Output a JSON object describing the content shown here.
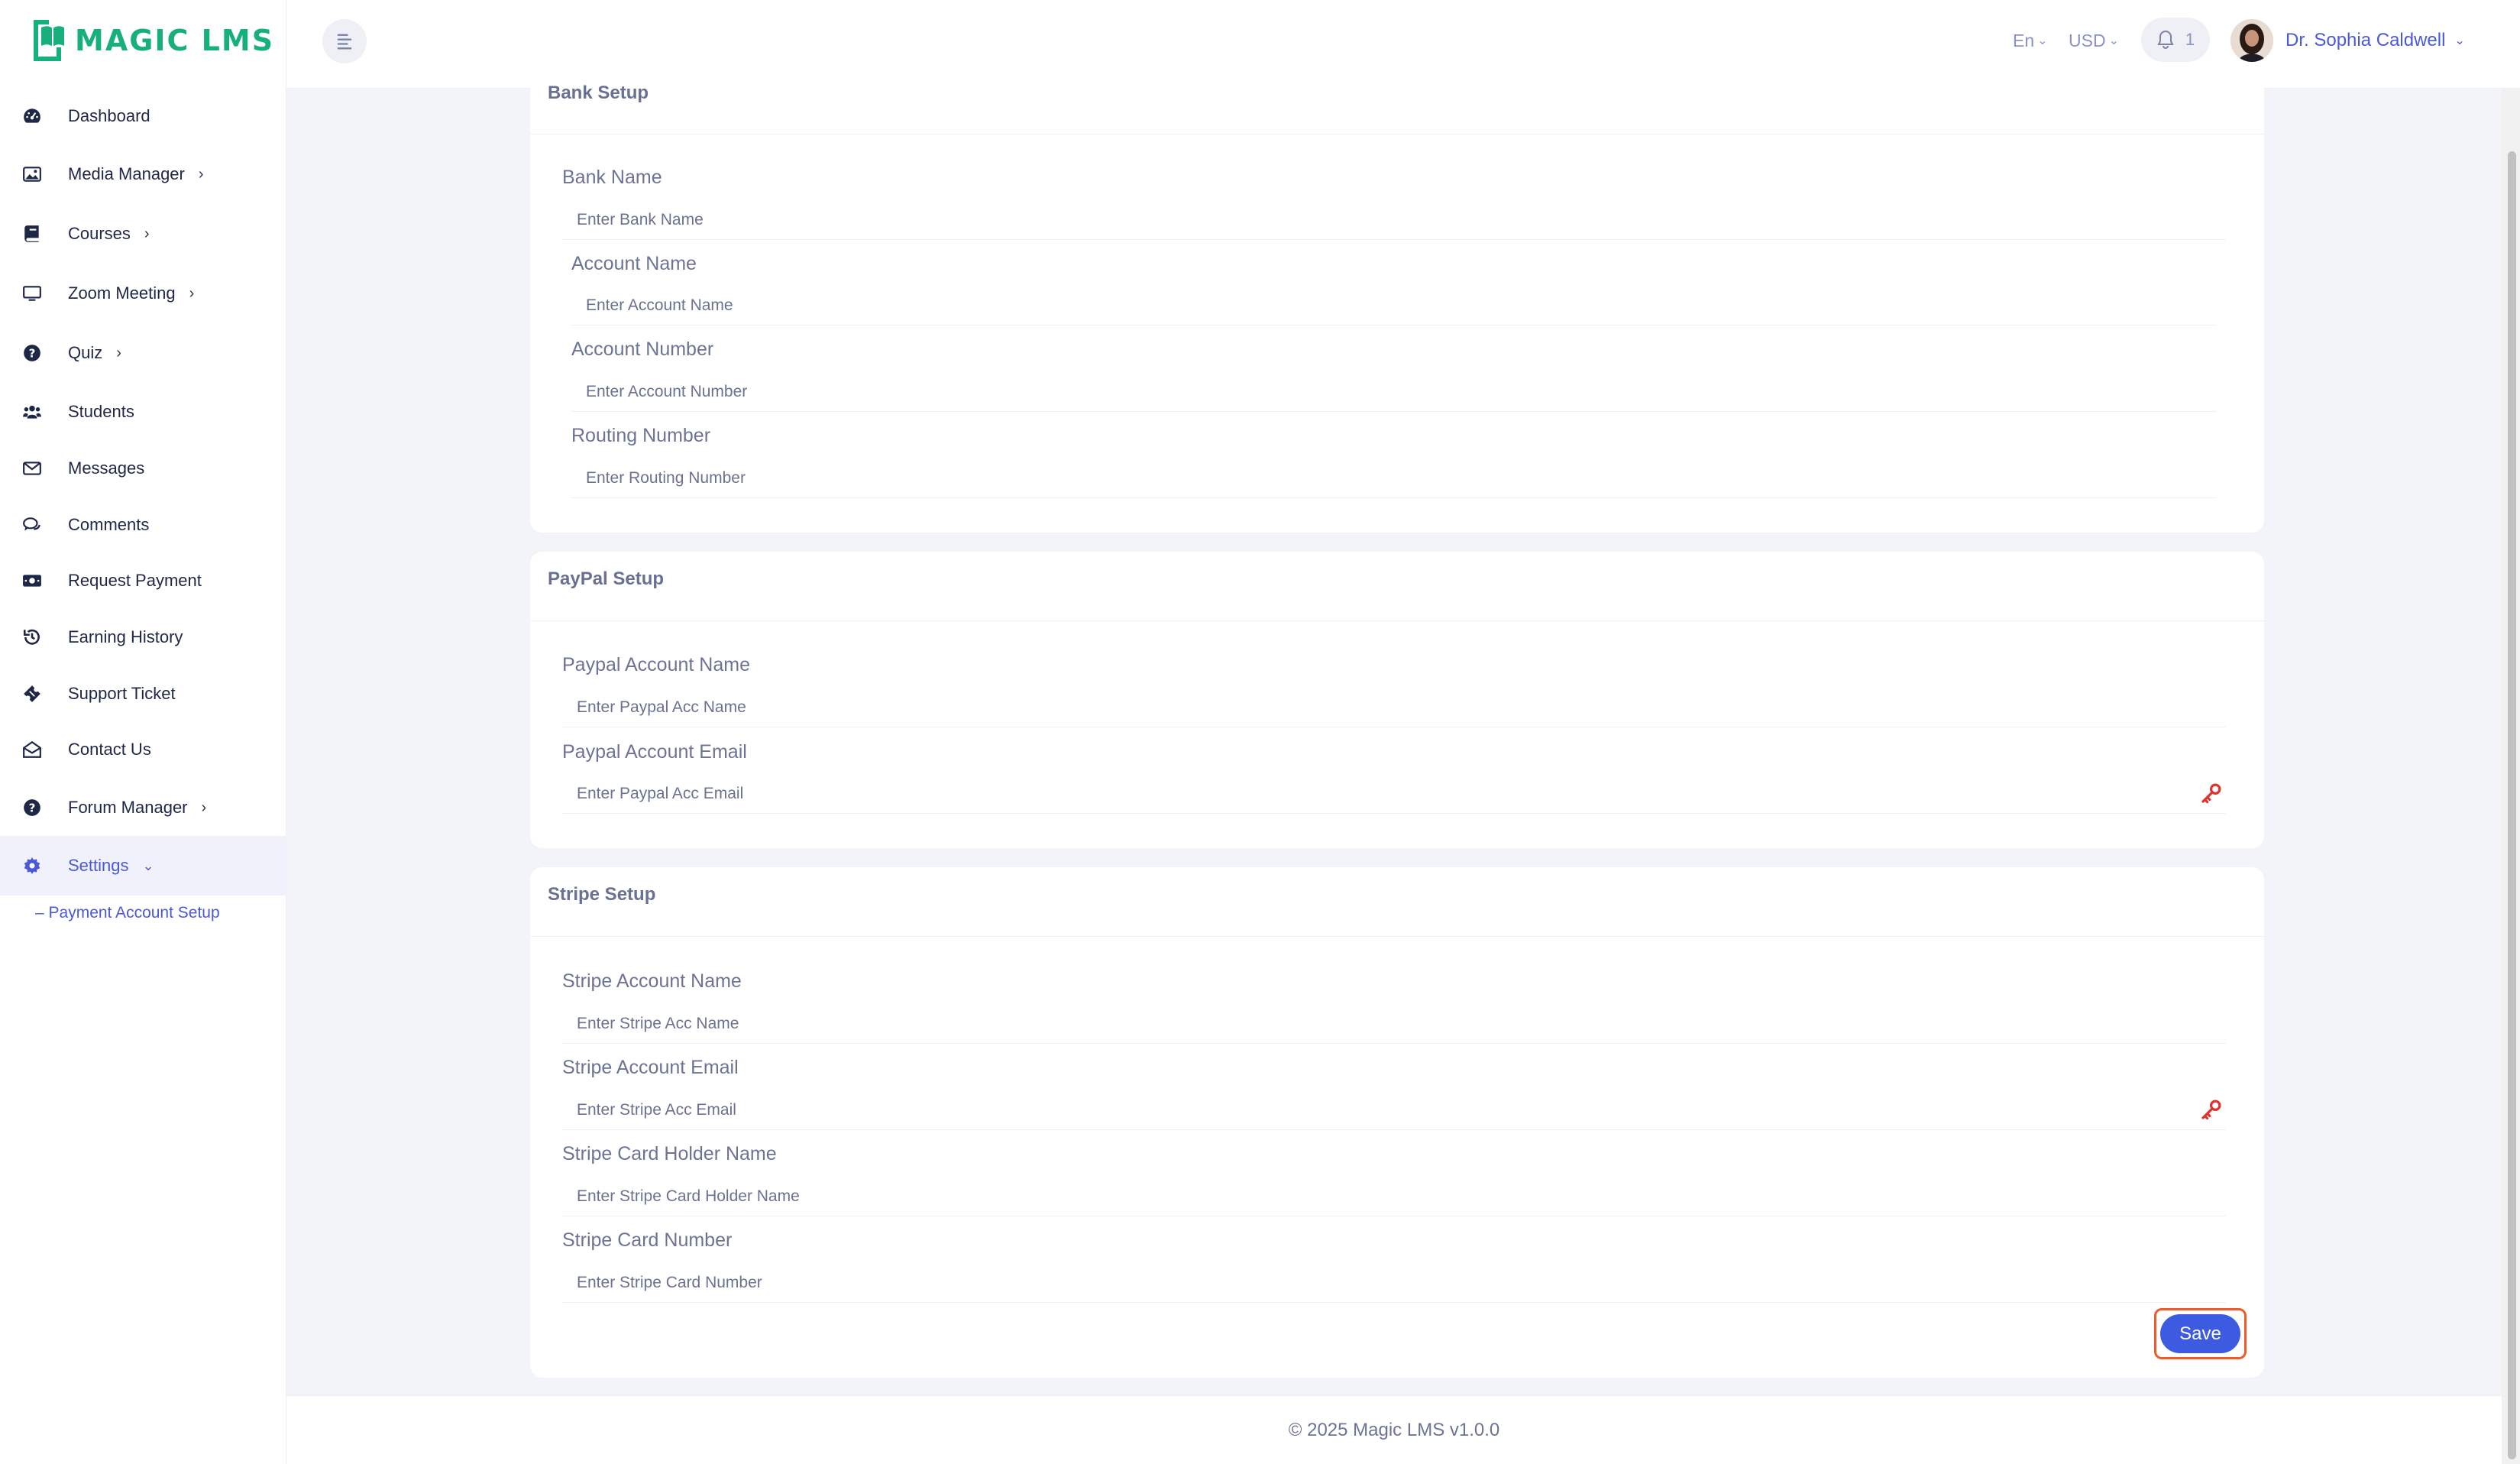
{
  "app": {
    "name": "MAGIC LMS",
    "brand_color": "#18b07a",
    "accent_color": "#4b58d8"
  },
  "sidebar": {
    "items": [
      {
        "label": "Dashboard",
        "icon": "dashboard-gauge-icon",
        "has_submenu": false
      },
      {
        "label": "Media Manager",
        "icon": "image-icon",
        "has_submenu": true
      },
      {
        "label": "Courses",
        "icon": "book-icon",
        "has_submenu": true
      },
      {
        "label": "Zoom Meeting",
        "icon": "monitor-icon",
        "has_submenu": true
      },
      {
        "label": "Quiz",
        "icon": "question-circle-icon",
        "has_submenu": true
      },
      {
        "label": "Students",
        "icon": "users-icon",
        "has_submenu": false
      },
      {
        "label": "Messages",
        "icon": "envelope-icon",
        "has_submenu": false
      },
      {
        "label": "Comments",
        "icon": "comments-icon",
        "has_submenu": false
      },
      {
        "label": "Request Payment",
        "icon": "money-bill-icon",
        "has_submenu": false
      },
      {
        "label": "Earning History",
        "icon": "history-icon",
        "has_submenu": false
      },
      {
        "label": "Support Ticket",
        "icon": "ticket-icon",
        "has_submenu": false
      },
      {
        "label": "Contact Us",
        "icon": "envelope-open-icon",
        "has_submenu": false
      },
      {
        "label": "Forum Manager",
        "icon": "question-circle-icon",
        "has_submenu": true
      },
      {
        "label": "Settings",
        "icon": "gear-icon",
        "has_submenu": true,
        "active": true
      }
    ],
    "subitem": "– Payment Account Setup"
  },
  "header": {
    "language": "En",
    "currency": "USD",
    "notification_count": "1",
    "user_name": "Dr. Sophia Caldwell"
  },
  "bank": {
    "title": "Bank Setup",
    "bank_name_label": "Bank Name",
    "bank_name_placeholder": "Enter Bank Name",
    "account_name_label": "Account Name",
    "account_name_placeholder": "Enter Account Name",
    "account_number_label": "Account Number",
    "account_number_placeholder": "Enter Account Number",
    "routing_number_label": "Routing Number",
    "routing_number_placeholder": "Enter Routing Number"
  },
  "paypal": {
    "title": "PayPal Setup",
    "name_label": "Paypal Account Name",
    "name_placeholder": "Enter Paypal Acc Name",
    "email_label": "Paypal Account Email",
    "email_placeholder": "Enter Paypal Acc Email"
  },
  "stripe": {
    "title": "Stripe Setup",
    "name_label": "Stripe Account Name",
    "name_placeholder": "Enter Stripe Acc Name",
    "email_label": "Stripe Account Email",
    "email_placeholder": "Enter Stripe Acc Email",
    "holder_label": "Stripe Card Holder Name",
    "holder_placeholder": "Enter Stripe Card Holder Name",
    "card_label": "Stripe Card Number",
    "card_placeholder": "Enter Stripe Card Number",
    "save_label": "Save"
  },
  "footer": {
    "text": "© 2025 Magic LMS v1.0.0"
  }
}
